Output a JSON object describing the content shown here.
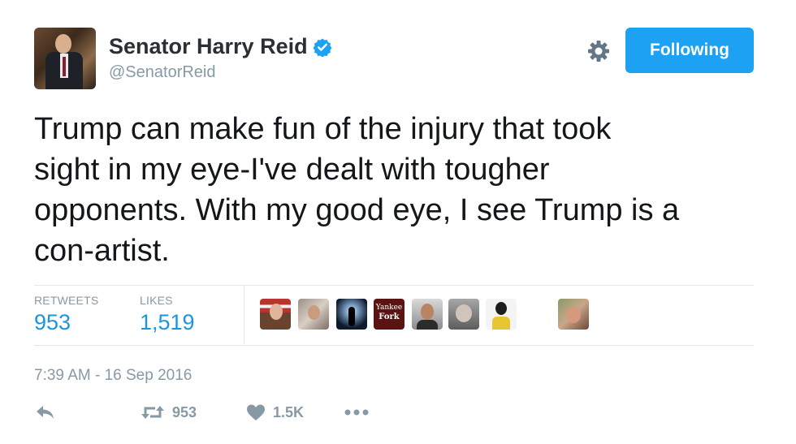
{
  "header": {
    "display_name": "Senator Harry Reid",
    "handle": "@SenatorReid",
    "follow_button_label": "Following",
    "avatar_icon": "profile-photo",
    "verified_icon": "verified-badge-icon",
    "settings_icon": "gear-icon"
  },
  "tweet": {
    "text": "Trump can make fun of the injury that took\nsight in my eye-I've dealt with tougher\nopponents. With my good eye, I see Trump is a\ncon-artist."
  },
  "stats": {
    "retweets_label": "RETWEETS",
    "retweets_value": "953",
    "likes_label": "LIKES",
    "likes_value": "1,519"
  },
  "likers": [
    {
      "name": "liker-avatar-1"
    },
    {
      "name": "liker-avatar-2"
    },
    {
      "name": "liker-avatar-3"
    },
    {
      "name": "liker-avatar-4",
      "text_line1": "Yankee",
      "text_line2": "Fork"
    },
    {
      "name": "liker-avatar-5"
    },
    {
      "name": "liker-avatar-6"
    },
    {
      "name": "liker-avatar-7"
    },
    {
      "name": "liker-avatar-8"
    }
  ],
  "timestamp": "7:39 AM - 16 Sep 2016",
  "actions": {
    "reply_icon": "reply-icon",
    "retweet_icon": "retweet-icon",
    "retweet_count": "953",
    "like_icon": "heart-icon",
    "like_count": "1.5K",
    "more_icon": "more-icon"
  },
  "colors": {
    "accent": "#1da1f2",
    "link": "#1b95e0",
    "muted": "#8899a6",
    "text": "#14171a",
    "divider": "#e1e8ed"
  }
}
